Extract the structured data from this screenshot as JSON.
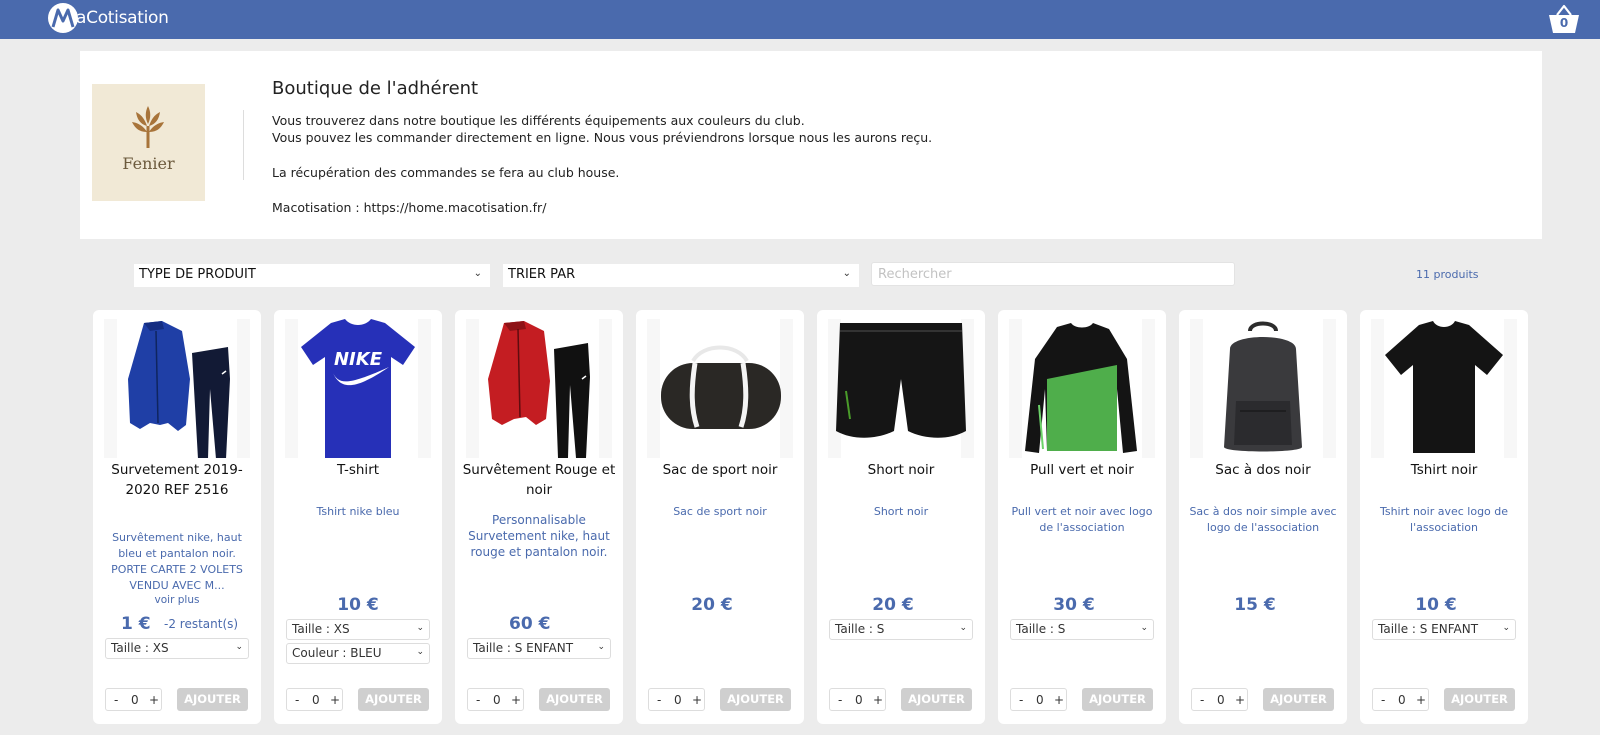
{
  "header": {
    "brand": "aCotisation",
    "cart_count": "0"
  },
  "intro": {
    "club_name": "Fenier",
    "title": "Boutique de l'adhérent",
    "line1": "Vous trouverez dans notre boutique les différents équipements aux couleurs du club.",
    "line2": "Vous pouvez les commander directement en ligne. Nous vous préviendrons lorsque nous les aurons reçu.",
    "line3": "La récupération des commandes se fera au club house.",
    "line4": "Macotisation : https://home.macotisation.fr/"
  },
  "filters": {
    "type_label": "TYPE DE PRODUIT",
    "sort_label": "TRIER PAR",
    "search_placeholder": "Rechercher",
    "count": "11 produits"
  },
  "products": [
    {
      "name_line1": "Survetement 2019-",
      "name_line2": "2020 REF 2516",
      "desc_line1": "Survêtement nike, haut",
      "desc_line2": "bleu et pantalon noir.",
      "desc_line3": "PORTE CARTE 2 VOLETS",
      "desc_line4": "VENDU AVEC M...",
      "see_more": "voir plus",
      "price": "1 €",
      "remaining": "-2 restant(s)",
      "size": "Taille : XS",
      "qty": "0",
      "image": "tracksuit-blue"
    },
    {
      "name": "T-shirt",
      "desc_line1": "Tshirt nike bleu",
      "price": "10 €",
      "size": "Taille : XS",
      "color": "Couleur : BLEU",
      "qty": "0",
      "image": "nike-tshirt-blue"
    },
    {
      "name_line1": "Survêtement Rouge et",
      "name_line2": "noir",
      "desc_line1": "Personnalisable",
      "desc_line2": "Survetement nike, haut",
      "desc_line3": "rouge et pantalon noir.",
      "price": "60 €",
      "size": "Taille : S ENFANT",
      "qty": "0",
      "image": "tracksuit-red"
    },
    {
      "name": "Sac de sport noir",
      "desc_line1": "Sac de sport noir",
      "price": "20 €",
      "qty": "0",
      "image": "duffel-bag"
    },
    {
      "name": "Short noir",
      "desc_line1": "Short noir",
      "price": "20 €",
      "size": "Taille : S",
      "qty": "0",
      "image": "black-shorts"
    },
    {
      "name": "Pull vert et noir",
      "desc_line1": "Pull vert et noir avec logo",
      "desc_line2": "de l'association",
      "price": "30 €",
      "size": "Taille : S",
      "qty": "0",
      "image": "green-sweater"
    },
    {
      "name": "Sac à dos noir",
      "desc_line1": "Sac à dos noir simple avec",
      "desc_line2": "logo de l'association",
      "price": "15 €",
      "qty": "0",
      "image": "backpack"
    },
    {
      "name": "Tshirt noir",
      "desc_line1": "Tshirt noir avec logo de",
      "desc_line2": "l'association",
      "price": "10 €",
      "size": "Taille : S ENFANT",
      "qty": "0",
      "image": "black-tshirt"
    }
  ],
  "labels": {
    "minus": "-",
    "plus": "+",
    "add": "AJOUTER",
    "chevron": "⌄"
  },
  "colors": {
    "brand_blue": "#4a6aad",
    "add_button_disabled": "#cfcfcf"
  }
}
